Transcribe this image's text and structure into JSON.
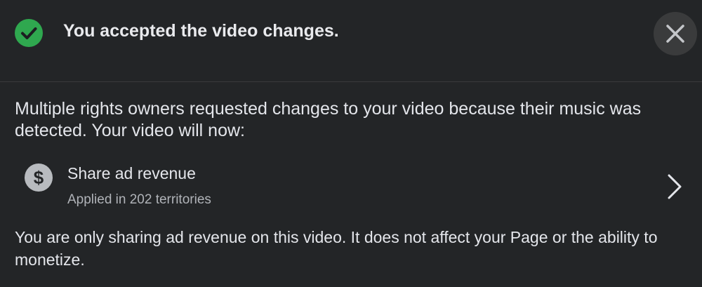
{
  "header": {
    "title": "You accepted the video changes.",
    "status_icon": "check-circle-icon",
    "close_icon": "close-icon"
  },
  "content": {
    "intro": "Multiple rights owners requested changes to your video because their music was detected. Your video will now:",
    "actions": [
      {
        "icon": "dollar-icon",
        "title": "Share ad revenue",
        "subtitle": "Applied in 202 territories"
      }
    ],
    "footer": "You are only sharing ad revenue on this video. It does not affect your Page or the ability to monetize."
  },
  "colors": {
    "background": "#232527",
    "success": "#2fa84f",
    "text_primary": "#e4e6eb",
    "text_secondary": "#b0b3b8"
  }
}
